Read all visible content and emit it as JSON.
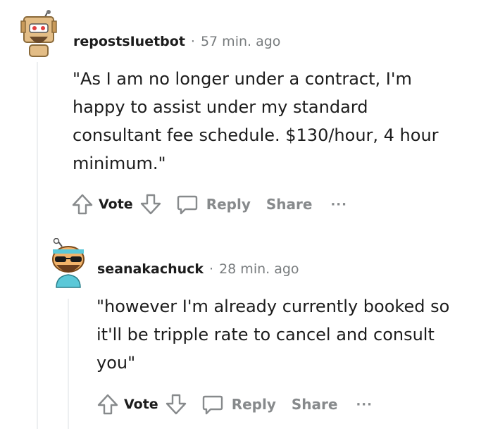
{
  "comments": [
    {
      "username": "repostsIuetbot",
      "separator": "·",
      "time": "57 min. ago",
      "body": "\"As I am no longer under a contract, I'm happy to assist under my standard consultant fee schedule. $130/hour, 4 hour minimum.\"",
      "body_lines": [
        "\"As I am no longer under a contract, I'm",
        "happy to assist under my standard",
        "consultant fee schedule. $130/hour, 4 hour",
        "minimum.\""
      ],
      "vote_label": "Vote",
      "reply_label": "Reply",
      "share_label": "Share",
      "more_label": "···",
      "avatar": "robot-snoo-avatar"
    },
    {
      "username": "seanakachuck",
      "separator": "·",
      "time": "28 min. ago",
      "body": "\"however I'm already currently booked so it'll be tripple rate to cancel and consult you\"",
      "body_lines": [
        "\"however I'm already currently booked so",
        "it'll be tripple rate to cancel and consult",
        "you\""
      ],
      "vote_label": "Vote",
      "reply_label": "Reply",
      "share_label": "Share",
      "more_label": "···",
      "avatar": "sunglasses-snoo-avatar"
    }
  ],
  "colors": {
    "text": "#1c1c1c",
    "meta": "#787c7e",
    "action": "#878a8c",
    "thread_line": "#edeff1"
  }
}
